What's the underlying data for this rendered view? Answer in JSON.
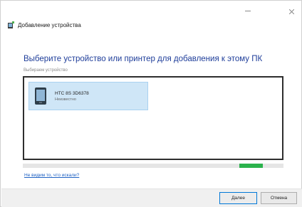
{
  "window": {
    "title": "Добавление устройства",
    "minimize_icon": "minimize-icon",
    "close_icon": "close-icon"
  },
  "main": {
    "heading": "Выберите устройство или принтер для добавления к этому ПК",
    "subheading": "Выбираем устройство"
  },
  "devices": [
    {
      "name": "HTC 8S 3D6378",
      "status": "Неизвестно",
      "icon": "phone-icon",
      "selected": true
    }
  ],
  "progress": {
    "value": 0.09
  },
  "links": {
    "help": "Не видим то, что искали?"
  },
  "buttons": {
    "next": "Далее",
    "cancel": "Отмена"
  },
  "colors": {
    "heading": "#1f3e9a",
    "progress": "#2bb24c",
    "selection": "#cfe6f7",
    "link": "#1f62c4"
  }
}
